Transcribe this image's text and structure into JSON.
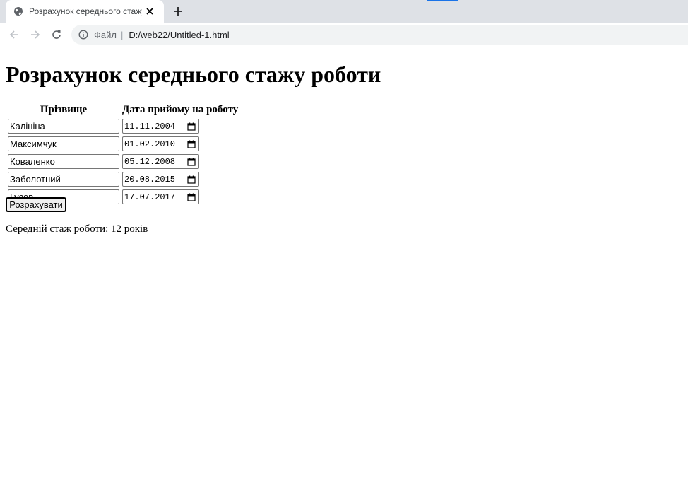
{
  "browser": {
    "tab_title": "Розрахунок середнього стажу р",
    "scheme_label": "Файл",
    "separator": "|",
    "url": "D:/web22/Untitled-1.html"
  },
  "page": {
    "heading": "Розрахунок середнього стажу роботи",
    "table": {
      "headers": [
        "Прізвище",
        "Дата прийому на роботу"
      ],
      "rows": [
        {
          "surname": "Калініна",
          "date": "11.11.2004"
        },
        {
          "surname": "Максимчук",
          "date": "01.02.2010"
        },
        {
          "surname": "Коваленко",
          "date": "05.12.2008"
        },
        {
          "surname": "Заболотний",
          "date": "20.08.2015"
        },
        {
          "surname": "Гусев",
          "date": "17.07.2017"
        }
      ]
    },
    "calculate_label": "Розрахувати",
    "result_text": "Середній стаж роботи: 12 років"
  },
  "icons": {
    "tab": "globe-icon",
    "close": "close-icon",
    "new_tab": "plus-icon",
    "back": "arrow-left-icon",
    "forward": "arrow-right-icon",
    "reload": "reload-icon",
    "site_info": "info-icon",
    "date_picker": "calendar-icon"
  },
  "colors": {
    "tab_strip": "#dee1e6",
    "omnibox": "#f1f3f4",
    "accent": "#1a73e8"
  }
}
